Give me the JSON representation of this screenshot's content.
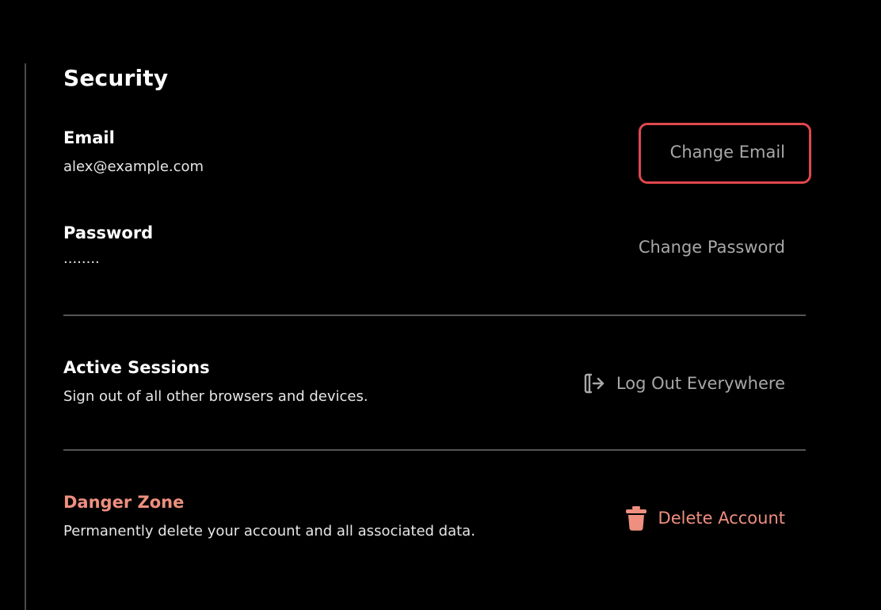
{
  "section": {
    "title": "Security"
  },
  "email": {
    "label": "Email",
    "value": "alex@example.com",
    "action_label": "Change Email"
  },
  "password": {
    "label": "Password",
    "value": "........",
    "action_label": "Change Password"
  },
  "sessions": {
    "label": "Active Sessions",
    "description": "Sign out of all other browsers and devices.",
    "action_label": "Log Out Everywhere",
    "action_icon": "logout-icon"
  },
  "danger": {
    "label": "Danger Zone",
    "description": "Permanently delete your account and all associated data.",
    "action_label": "Delete Account",
    "action_icon": "trash-icon"
  },
  "colors": {
    "background": "#000000",
    "text": "#ffffff",
    "muted": "#a8a8a8",
    "danger": "#ee8f7f",
    "focus_ring": "#e0474c",
    "divider": "#555555"
  }
}
